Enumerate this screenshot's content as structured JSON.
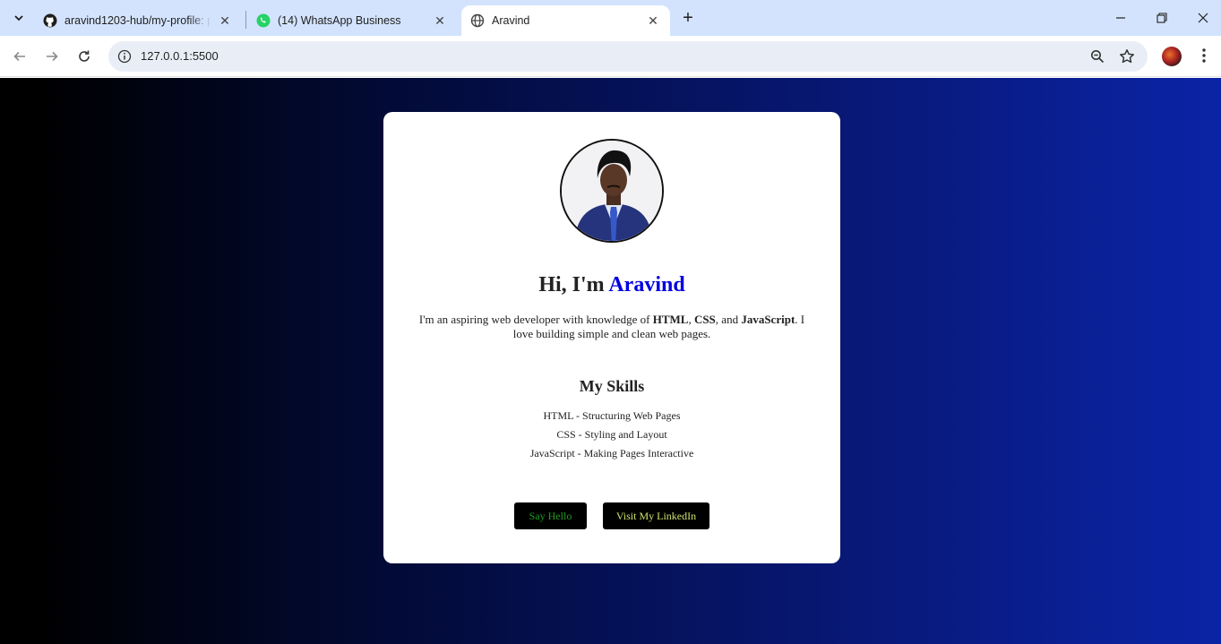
{
  "browser": {
    "tabs": [
      {
        "title": "aravind1203-hub/my-profile: pe",
        "favicon": "github-icon",
        "active": false
      },
      {
        "title": "(14) WhatsApp Business",
        "favicon": "whatsapp-icon",
        "active": false
      },
      {
        "title": "Aravind",
        "favicon": "globe-icon",
        "active": true
      }
    ],
    "url": "127.0.0.1:5500"
  },
  "profile": {
    "greeting_prefix": "Hi, I'm ",
    "name": "Aravind",
    "intro_before": "I'm an aspiring web developer with knowledge of ",
    "intro_html": "HTML",
    "intro_sep1": ", ",
    "intro_css": "CSS",
    "intro_sep2": ", and ",
    "intro_js": "JavaScript",
    "intro_after": ". I love building simple and clean web pages.",
    "skills_title": "My Skills",
    "skills": [
      "HTML - Structuring Web Pages",
      "CSS - Styling and Layout",
      "JavaScript - Making Pages Interactive"
    ],
    "buttons": {
      "hello": "Say Hello",
      "linkedin": "Visit My LinkedIn"
    }
  },
  "colors": {
    "name_accent": "#0000e0",
    "hello_text": "#1f9c1f",
    "linkedin_text": "#cde36a",
    "background_end": "#0b24a6"
  }
}
